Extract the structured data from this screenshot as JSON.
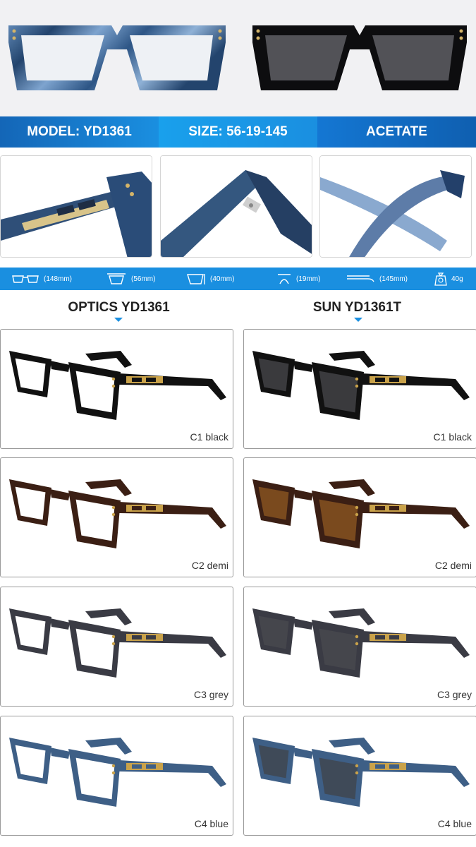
{
  "specs": {
    "model": "MODEL: YD1361",
    "size": "SIZE: 56-19-145",
    "material": "ACETATE"
  },
  "measurements": [
    {
      "icon": "frame-width-icon",
      "text": "(148mm)"
    },
    {
      "icon": "lens-width-icon",
      "text": "(56mm)"
    },
    {
      "icon": "lens-height-icon",
      "text": "(40mm)"
    },
    {
      "icon": "bridge-width-icon",
      "text": "(19mm)"
    },
    {
      "icon": "temple-length-icon",
      "text": "(145mm)"
    },
    {
      "icon": "weight-icon",
      "text": "40g"
    }
  ],
  "columns": {
    "optics": "OPTICS YD1361",
    "sun": "SUN YD1361T"
  },
  "variants": [
    {
      "optics_label": "C1 black",
      "sun_label": "C1 black",
      "frame_color": "#111111",
      "sun_lens_color": "#3a3a3d"
    },
    {
      "optics_label": "C2 demi",
      "sun_label": "C2 demi",
      "frame_color": "#3b1f14",
      "sun_lens_color": "#7a4a1e"
    },
    {
      "optics_label": "C3 grey",
      "sun_label": "C3 grey",
      "frame_color": "#3a3b44",
      "sun_lens_color": "#45464c"
    },
    {
      "optics_label": "C4 blue",
      "sun_label": "C4 blue",
      "frame_color": "#3e5f86",
      "sun_lens_color": "#3f4a58"
    }
  ],
  "colors": {
    "accent": "#1a8fe0",
    "hinge_gold": "#c9a24a"
  }
}
